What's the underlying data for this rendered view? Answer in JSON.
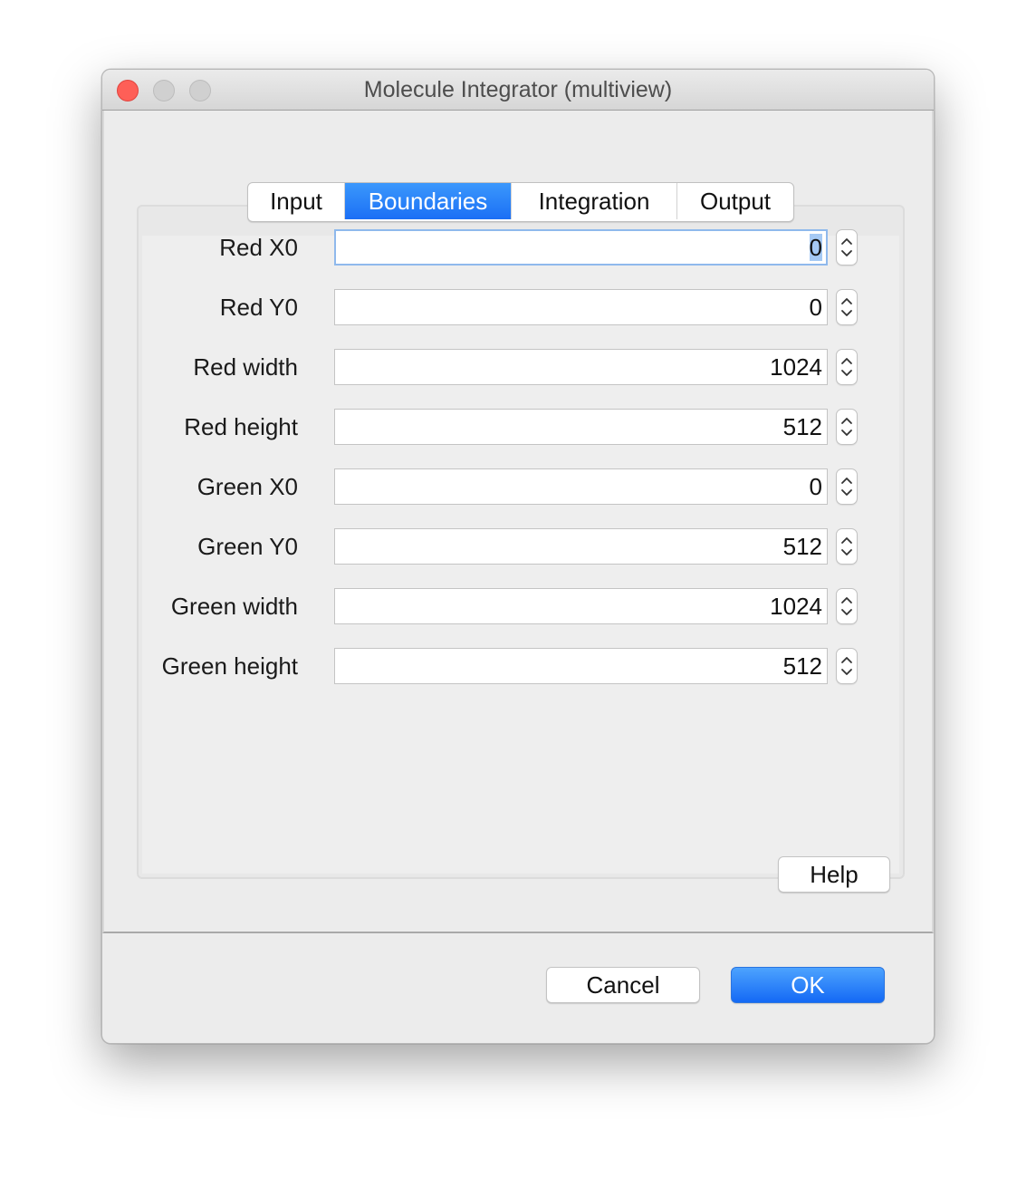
{
  "window": {
    "title": "Molecule Integrator (multiview)"
  },
  "tabs": [
    {
      "label": "Input",
      "active": false
    },
    {
      "label": "Boundaries",
      "active": true
    },
    {
      "label": "Integration",
      "active": false
    },
    {
      "label": "Output",
      "active": false
    }
  ],
  "fields": [
    {
      "label": "Red X0",
      "value": "0"
    },
    {
      "label": "Red Y0",
      "value": "0"
    },
    {
      "label": "Red width",
      "value": "1024"
    },
    {
      "label": "Red height",
      "value": "512"
    },
    {
      "label": "Green X0",
      "value": "0"
    },
    {
      "label": "Green Y0",
      "value": "512"
    },
    {
      "label": "Green width",
      "value": "1024"
    },
    {
      "label": "Green height",
      "value": "512"
    }
  ],
  "buttons": {
    "help": "Help",
    "cancel": "Cancel",
    "ok": "OK"
  },
  "colors": {
    "accent": "#1b6ff5",
    "close": "#fe5f57"
  }
}
